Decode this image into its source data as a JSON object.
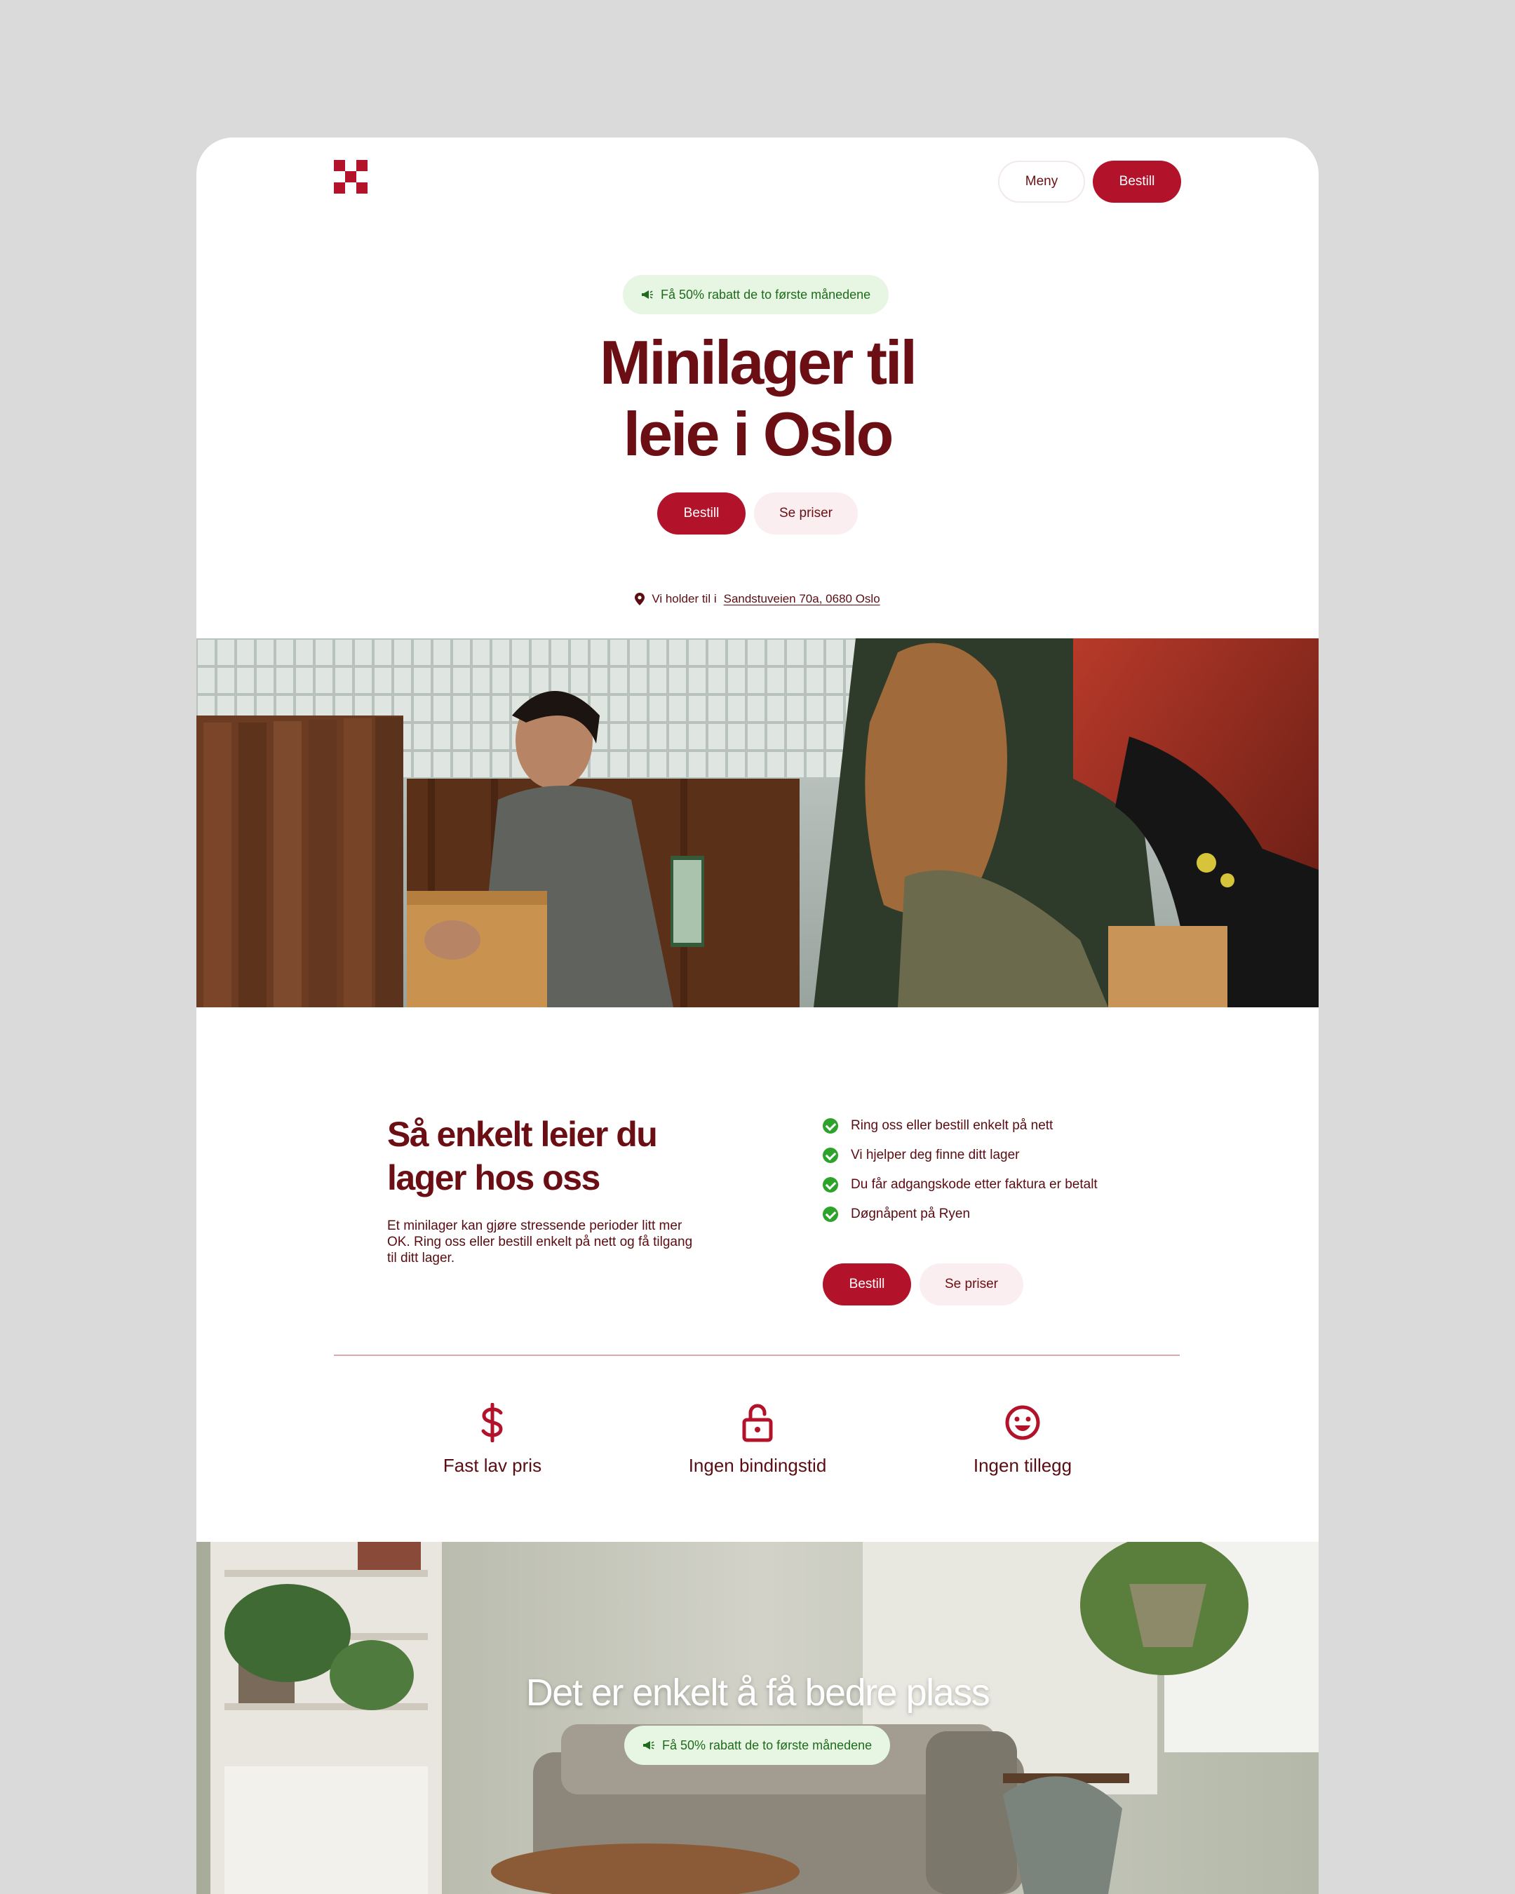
{
  "header": {
    "logo_name": "checker-logo",
    "menu_label": "Meny",
    "order_label": "Bestill"
  },
  "hero": {
    "promo_text": "Få 50% rabatt de to første månedene",
    "title_line1": "Minilager til",
    "title_line2": "leie i Oslo",
    "primary_cta": "Bestill",
    "secondary_cta": "Se priser",
    "location_prefix": "Vi holder til i",
    "location_address": "Sandstuveien 70a, 0680 Oslo"
  },
  "how_it_works": {
    "title_line1": "Så enkelt leier du",
    "title_line2": "lager hos oss",
    "description": "Et minilager kan gjøre stressende perioder litt mer OK. Ring oss eller bestill enkelt på nett og få tilgang til ditt lager.",
    "checklist": [
      "Ring oss eller bestill enkelt på nett",
      "Vi hjelper deg finne ditt lager",
      "Du får adgangskode etter faktura er betalt",
      "Døgnåpent på Ryen"
    ],
    "primary_cta": "Bestill",
    "secondary_cta": "Se priser"
  },
  "features": [
    {
      "icon": "dollar-icon",
      "label": "Fast lav pris"
    },
    {
      "icon": "unlock-icon",
      "label": "Ingen bindingstid"
    },
    {
      "icon": "smiley-icon",
      "label": "Ingen tillegg"
    }
  ],
  "bottom_banner": {
    "title": "Det er enkelt å få bedre plass",
    "promo_text": "Få 50% rabatt de to første månedene"
  },
  "colors": {
    "brand": "#b3132a",
    "heading": "#6b0f14",
    "promo_bg": "#e7f6e2",
    "promo_text": "#1f6b1d",
    "check": "#2da32c",
    "page_bg": "#dadada"
  }
}
